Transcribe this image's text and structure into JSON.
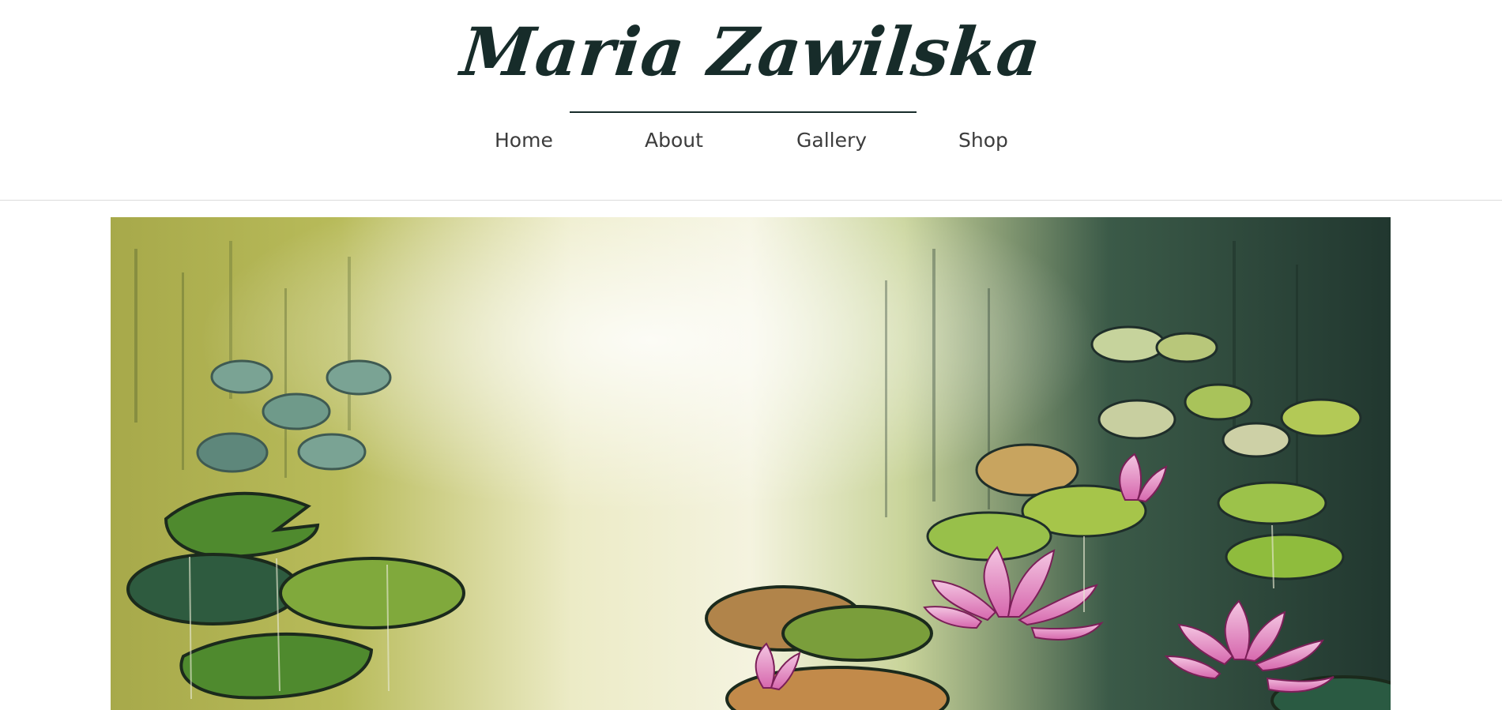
{
  "header": {
    "logo_text": "Maria Zawilska",
    "nav": [
      {
        "label": "Home"
      },
      {
        "label": "About"
      },
      {
        "label": "Gallery"
      },
      {
        "label": "Shop"
      }
    ]
  },
  "hero": {
    "subject": "painting-water-lilies",
    "colors": {
      "light_center": "#f2f1dc",
      "olive": "#a9ab3c",
      "dark_teal": "#1f3a35",
      "lily_green": "#7aa83a",
      "pink": "#e28ac2"
    }
  }
}
